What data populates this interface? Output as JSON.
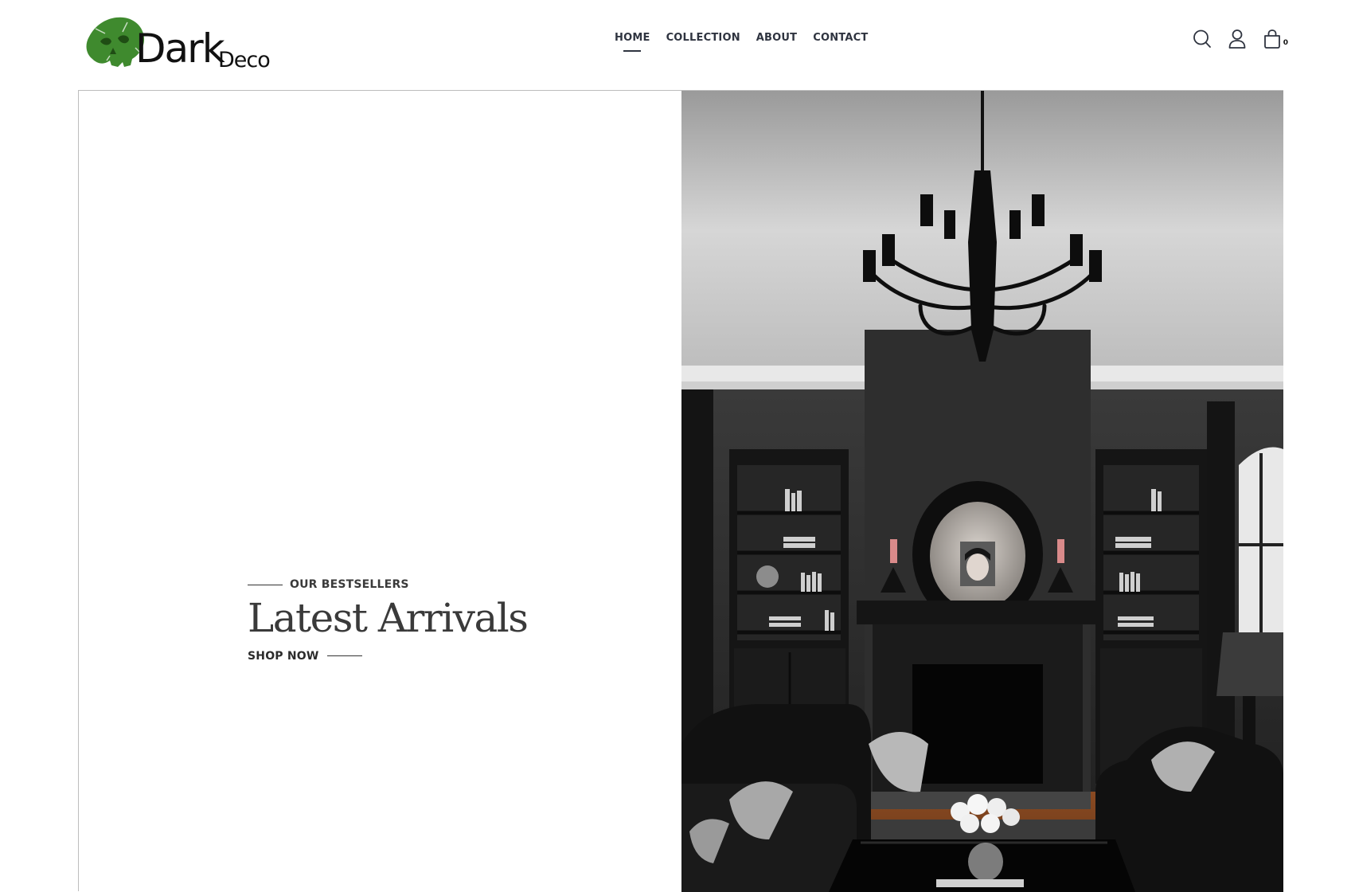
{
  "brand": {
    "name": "Dark",
    "sub": "Deco",
    "logo_color": "#3f8a2e"
  },
  "nav": {
    "items": [
      {
        "label": "HOME",
        "active": true
      },
      {
        "label": "COLLECTION",
        "active": false
      },
      {
        "label": "ABOUT",
        "active": false
      },
      {
        "label": "CONTACT",
        "active": false
      }
    ]
  },
  "header_icons": {
    "search": "search-icon",
    "account": "user-icon",
    "cart": "shopping-bag-icon",
    "cart_count": "0"
  },
  "hero": {
    "eyebrow": "OUR BESTSELLERS",
    "title": "Latest Arrivals",
    "cta": "SHOP NOW",
    "image": "gothic-living-room-photo"
  },
  "colors": {
    "text": "#2b2b2b",
    "border": "#bdbdbd",
    "logo_green": "#3f8a2e"
  }
}
